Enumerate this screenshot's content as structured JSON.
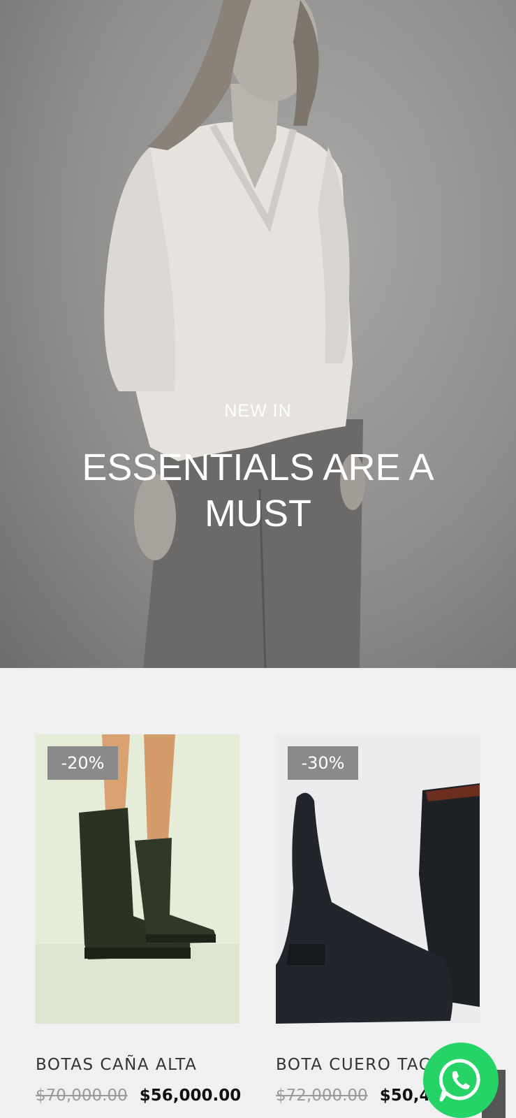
{
  "hero": {
    "subtitle": "NEW IN",
    "title": "ESSENTIALS ARE A MUST"
  },
  "products": [
    {
      "badge": "-20%",
      "name": "BOTAS CAÑA ALTA",
      "old_price": "$70,000.00",
      "price": "$56,000.00"
    },
    {
      "badge": "-30%",
      "name": "BOTA CUERO TACO",
      "old_price": "$72,000.00",
      "price": "$50,400.00"
    }
  ],
  "whatsapp": {
    "icon": "whatsapp-icon",
    "color": "#25d366"
  },
  "colors": {
    "page_background": "#f0f0f0",
    "badge_background": "#8a8a8a"
  }
}
